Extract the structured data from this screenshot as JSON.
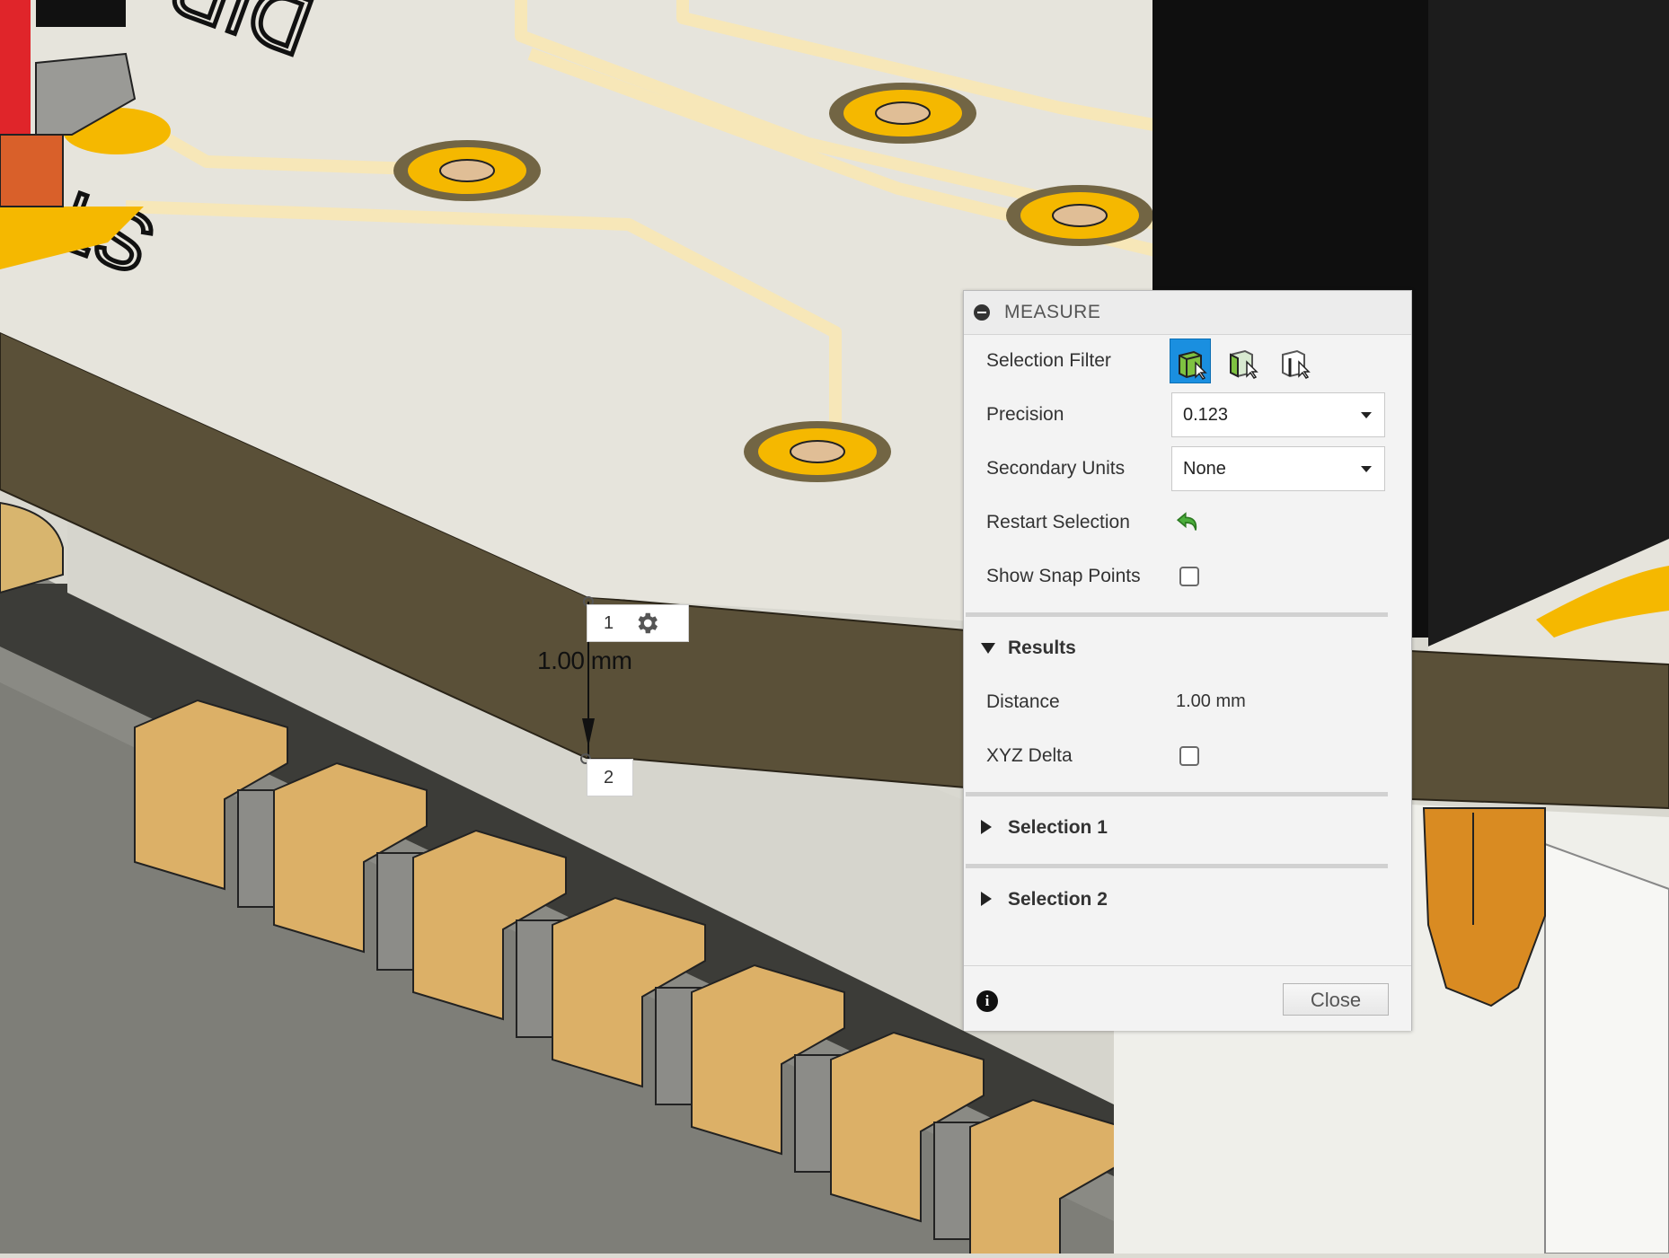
{
  "measure_panel": {
    "title": "MEASURE",
    "selection_filter_label": "Selection Filter",
    "selection_filter_options": [
      "body-select-icon",
      "face-select-icon",
      "edge-select-icon"
    ],
    "selection_filter_active": "body-select-icon",
    "precision_label": "Precision",
    "precision_value": "0.123",
    "secondary_units_label": "Secondary Units",
    "secondary_units_value": "None",
    "restart_selection_label": "Restart Selection",
    "show_snap_points_label": "Show Snap Points",
    "show_snap_points_checked": false,
    "results_label": "Results",
    "distance_label": "Distance",
    "distance_value": "1.00 mm",
    "xyz_delta_label": "XYZ Delta",
    "xyz_delta_checked": false,
    "selection1_label": "Selection 1",
    "selection2_label": "Selection 2",
    "close_label": "Close"
  },
  "viewport": {
    "point1_label": "1",
    "point2_label": "2",
    "dimension_text": "1.00 mm",
    "pcb_text_1": "STEP",
    "pcb_text_2": "DIR"
  },
  "colors": {
    "accent_blue": "#1a8fe0",
    "pad_gold": "#f5b800",
    "board_dark": "#5a5038",
    "board_surface": "#e6e4dc",
    "connector_pin": "#d98b22"
  }
}
